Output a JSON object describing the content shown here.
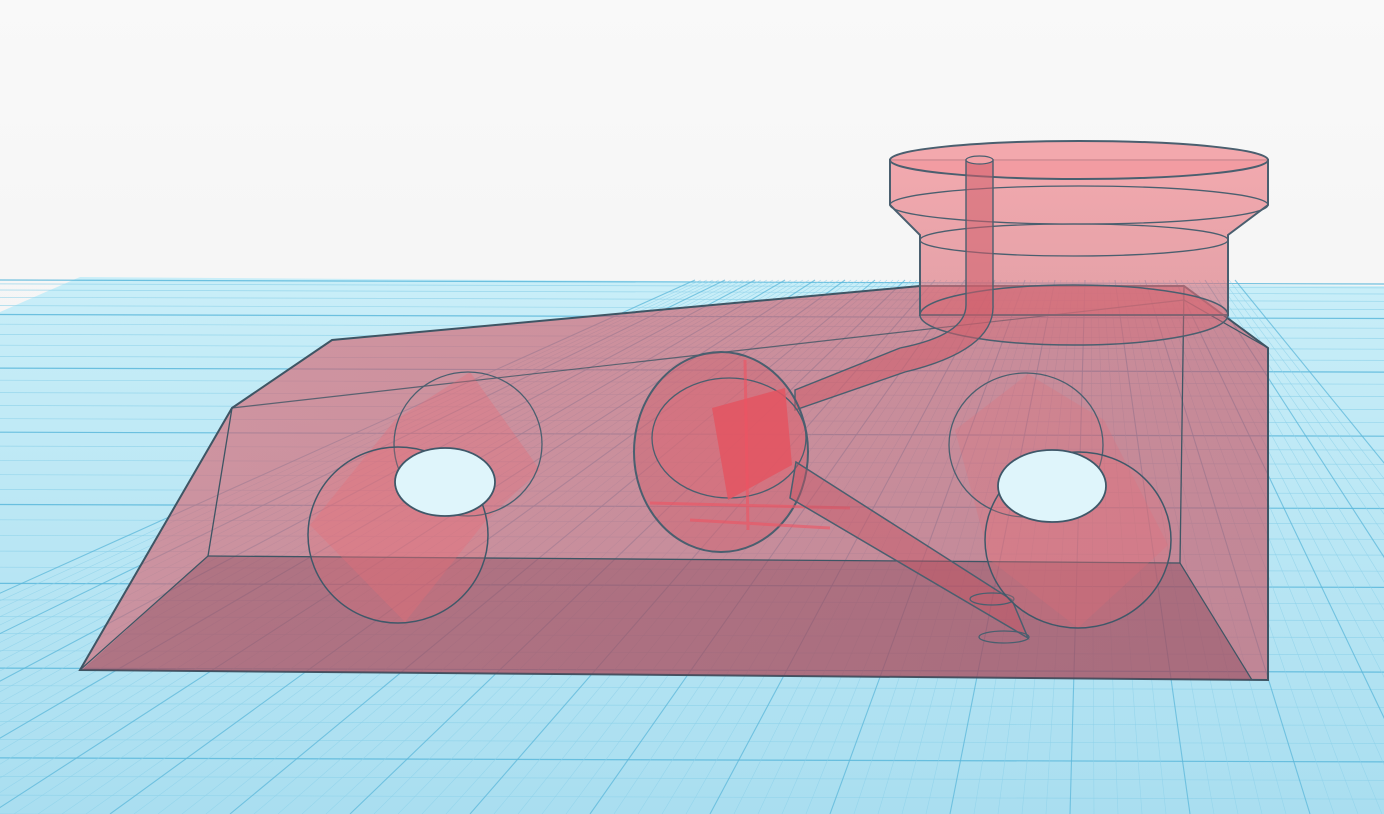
{
  "app": {
    "mode": "3d-workplane-view"
  },
  "colors": {
    "background": "#f6f6f6",
    "workplane_fill": "#aee3f3",
    "grid_major": "#5bb7da",
    "grid_minor": "#8fd2ea",
    "shape_fill": "#e45a67",
    "shape_stroke": "#34495e"
  },
  "scene": {
    "shapes": [
      {
        "name": "angled-base-block",
        "kind": "box-with-slope",
        "transparency": "transparent"
      },
      {
        "name": "top-cylinder-cap",
        "kind": "cylinder",
        "transparency": "transparent"
      },
      {
        "name": "left-hole-cylinder",
        "kind": "cylinder-hole"
      },
      {
        "name": "middle-sphere-cavity",
        "kind": "sphere-hole"
      },
      {
        "name": "right-hole-cylinder",
        "kind": "cylinder-hole"
      },
      {
        "name": "bent-pipe",
        "kind": "tube"
      },
      {
        "name": "angled-pipe",
        "kind": "tube"
      }
    ]
  }
}
